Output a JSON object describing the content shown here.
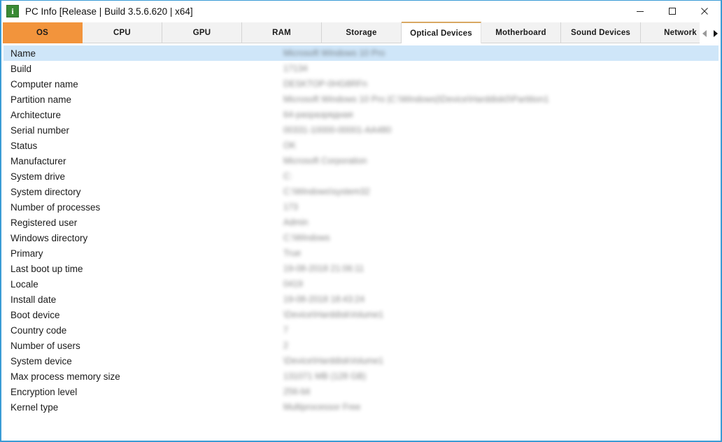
{
  "window": {
    "title": "PC Info [Release | Build 3.5.6.620 | x64]",
    "icon": "info-icon",
    "accent_orange": "#f2943c",
    "border_blue": "#3a9bd5",
    "selection_blue": "#cfe6f9",
    "controls": {
      "minimize": "—",
      "maximize": "☐",
      "close": "✕"
    }
  },
  "tabs": {
    "selected": "OS",
    "hovered": "Optical Devices",
    "items": [
      {
        "label": "OS"
      },
      {
        "label": "CPU"
      },
      {
        "label": "GPU"
      },
      {
        "label": "RAM"
      },
      {
        "label": "Storage"
      },
      {
        "label": "Optical Devices"
      },
      {
        "label": "Motherboard"
      },
      {
        "label": "Sound Devices"
      },
      {
        "label": "Network"
      }
    ],
    "scroll_left": "scroll-left-icon",
    "scroll_right": "scroll-right-icon"
  },
  "list": {
    "selected_index": 0,
    "rows": [
      {
        "label": "Name",
        "value": "Microsoft Windows 10 Pro"
      },
      {
        "label": "Build",
        "value": "17134"
      },
      {
        "label": "Computer name",
        "value": "DESKTOP-0HG8RFn"
      },
      {
        "label": "Partition name",
        "value": "Microsoft Windows 10 Pro |C:\\Windows|\\Device\\Harddisk0\\Partition1"
      },
      {
        "label": "Architecture",
        "value": "64-paspaзрядная"
      },
      {
        "label": "Serial number",
        "value": "00331-10000-00001-AA480"
      },
      {
        "label": "Status",
        "value": "OK"
      },
      {
        "label": "Manufacturer",
        "value": "Microsoft Corporation"
      },
      {
        "label": "System drive",
        "value": "C:"
      },
      {
        "label": "System directory",
        "value": "C:\\Windows\\system32"
      },
      {
        "label": "Number of processes",
        "value": "173"
      },
      {
        "label": "Registered user",
        "value": "Admin"
      },
      {
        "label": "Windows directory",
        "value": "C:\\Windows"
      },
      {
        "label": "Primary",
        "value": "True"
      },
      {
        "label": "Last boot up time",
        "value": "19-08-2018 21:06:11"
      },
      {
        "label": "Locale",
        "value": "0419"
      },
      {
        "label": "Install date",
        "value": "19-08-2018 18:43:24"
      },
      {
        "label": "Boot device",
        "value": "\\Device\\HarddiskVolume1"
      },
      {
        "label": "Country code",
        "value": "7"
      },
      {
        "label": "Number of users",
        "value": "2"
      },
      {
        "label": "System device",
        "value": "\\Device\\HarddiskVolume1"
      },
      {
        "label": "Max process memory size",
        "value": "131071 MB (128 GB)"
      },
      {
        "label": "Encryption level",
        "value": "256-bit"
      },
      {
        "label": "Kernel type",
        "value": "Multiprocessor Free"
      }
    ]
  }
}
